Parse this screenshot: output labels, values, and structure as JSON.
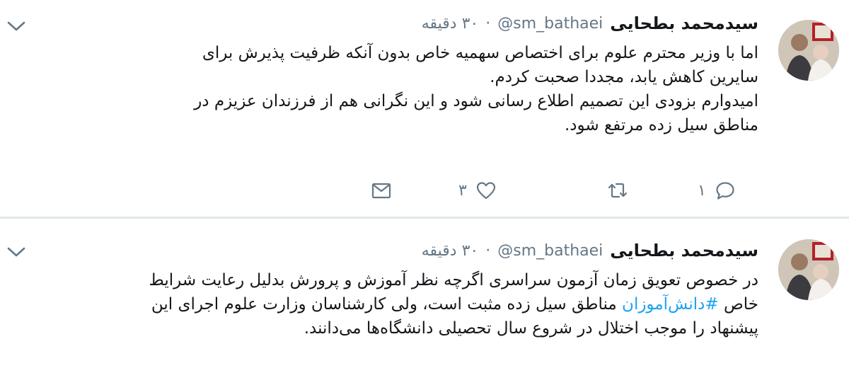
{
  "tweets": [
    {
      "author_name": "سیدمحمد بطحایی",
      "handle": "@sm_bathaei",
      "separator": "·",
      "time": "۳۰ دقیقه",
      "lines": [
        "اما با وزیر محترم علوم برای اختصاص سهمیه خاص بدون آنکه ظرفیت پذیرش برای",
        "سایرین کاهش یابد، مجددا صحبت کردم.",
        "امیدوارم بزودی این تصمیم اطلاع رسانی شود و این نگرانی هم از فرزندان عزیزم در",
        "مناطق سیل زده مرتفع شود."
      ],
      "reply_count": "۱",
      "like_count": "۳"
    },
    {
      "author_name": "سیدمحمد بطحایی",
      "handle": "@sm_bathaei",
      "separator": "·",
      "time": "۳۰ دقیقه",
      "line1": "در خصوص تعویق زمان آزمون سراسری اگرچه نظر آموزش و پرورش بدلیل رعایت شرایط",
      "line2_before": "خاص ",
      "hashtag": "#دانش‌آموزان",
      "line2_after": " مناطق سیل زده مثبت است، ولی کارشناسان وزارت علوم اجرای این",
      "line3": "پیشنهاد را موجب اختلال در شروع سال تحصیلی دانشگاه‌ها می‌دانند."
    }
  ],
  "icons": {
    "reply": "reply-icon",
    "retweet": "retweet-icon",
    "like": "heart-icon",
    "message": "envelope-icon",
    "menu": "chevron-down-icon",
    "avatar": "avatar"
  },
  "colors": {
    "text": "#14171a",
    "muted": "#657786",
    "link": "#1da1f2",
    "divider": "#e1e8ed"
  }
}
